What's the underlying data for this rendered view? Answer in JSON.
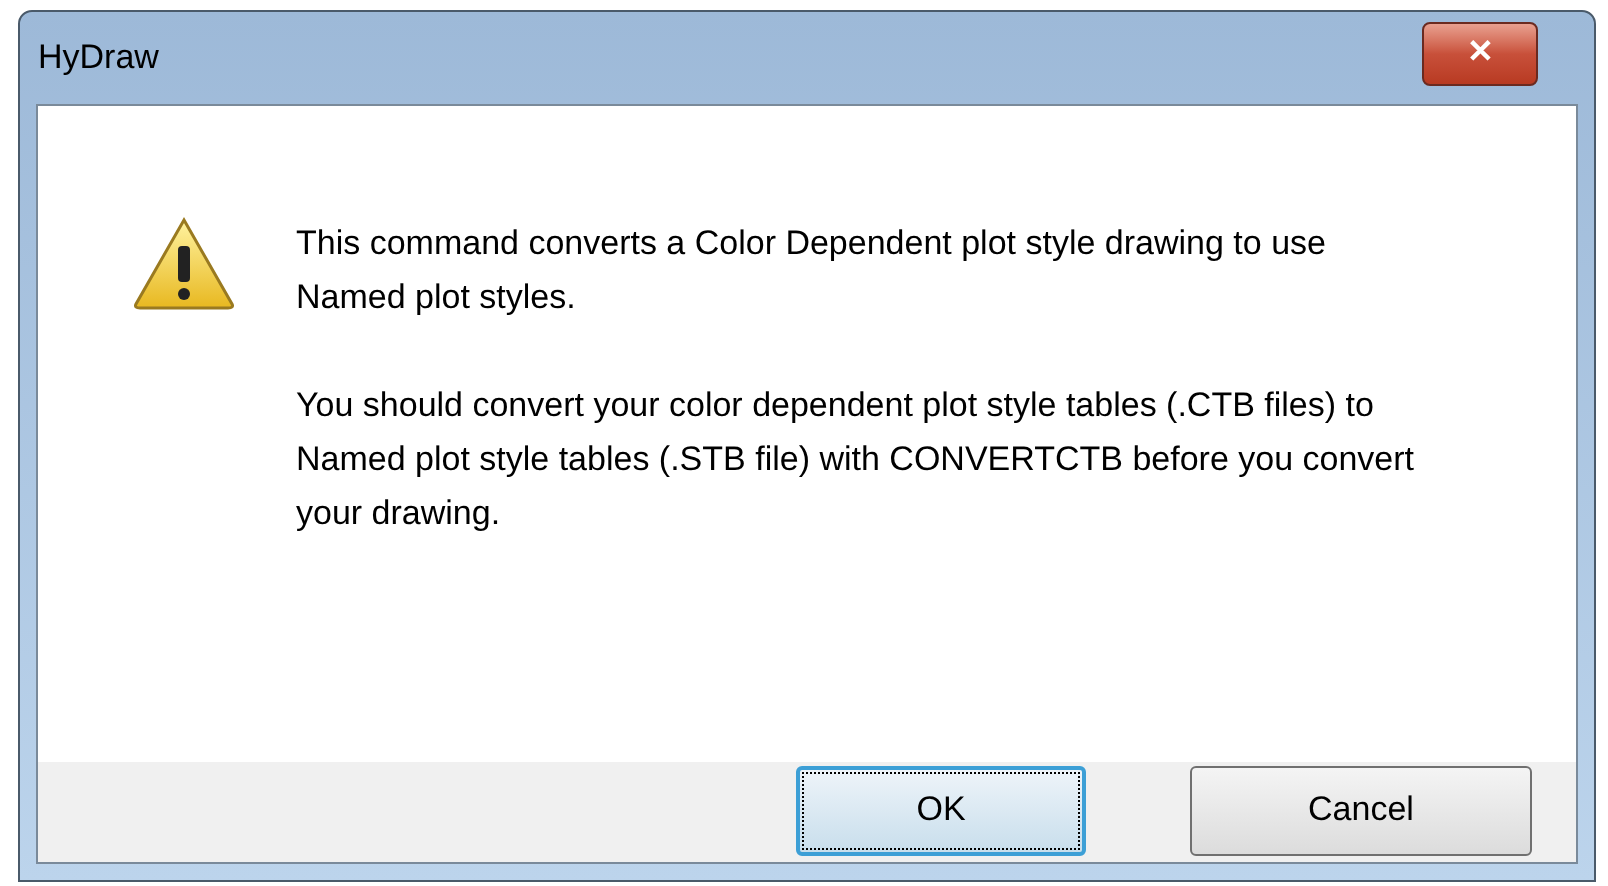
{
  "window": {
    "title": "HyDraw",
    "close": "✕"
  },
  "message": {
    "paragraphs": [
      "This command converts a Color Dependent plot style drawing to use Named plot styles.",
      "You should convert your color dependent plot style tables (.CTB files) to Named plot style tables (.STB file) with CONVERTCTB before you convert your drawing."
    ]
  },
  "buttons": [
    {
      "label": "OK",
      "focused": true
    },
    {
      "label": "Cancel",
      "focused": false
    }
  ]
}
